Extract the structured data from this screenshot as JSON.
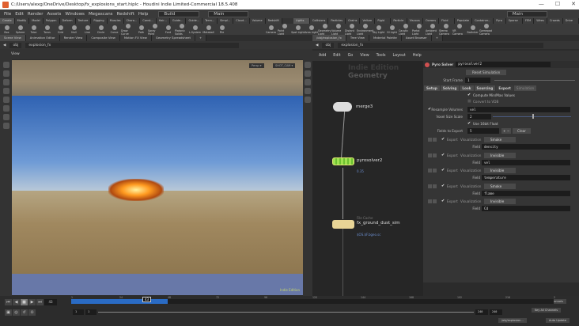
{
  "window": {
    "title": "C:/Users/alexg/OneDrive/Desktop/fx_explosions_start.hiplc - Houdini Indie Limited-Commercial 18.5.408",
    "controls": [
      "—",
      "☐",
      "✕"
    ]
  },
  "menu": {
    "items": [
      "File",
      "Edit",
      "Render",
      "Assets",
      "Windows",
      "Megascans",
      "Redshift",
      "Help"
    ],
    "desktop": "Build",
    "desktop_right": "Main"
  },
  "shelf_tabs": [
    "Create",
    "Modify",
    "Model",
    "Polygon",
    "Deform",
    "Texture",
    "Rigging",
    "Muscles",
    "Chara...",
    "Const...",
    "Hair...",
    "Guide...",
    "Guide...",
    "Terra...",
    "Simpl...",
    "Cloud...",
    "Volume",
    "Redshift",
    "Lights and...",
    "Collisions",
    "Particles",
    "Grains",
    "Vellum",
    "Rigid Bod...",
    "Particle Fl...",
    "Viscous Fl...",
    "Oceans",
    "Fluid Con...",
    "Populate C...",
    "Container...",
    "Pyro FX",
    "Sparse Pyr...",
    "FEM",
    "Wires",
    "Crowds",
    "Drive Sim..."
  ],
  "shelf_tools": [
    "Box",
    "Sphere",
    "Tube",
    "Torus",
    "Grid",
    "Null",
    "Line",
    "Circle",
    "Curve",
    "Draw Curve",
    "Path",
    "Spray Paint",
    "Font",
    "Platonic Solids",
    "L-System",
    "Metaball",
    "File",
    "Camera",
    "Point Light",
    "Spot Light",
    "Area Light",
    "Geometry Light",
    "Volume Light",
    "Distant Light",
    "Environment Light",
    "Sky Light",
    "GI Light",
    "Caustic Light",
    "Portal Light",
    "Ambient Light",
    "Stereo Camera",
    "VR Camera",
    "Switcher",
    "Gamepad Camera"
  ],
  "left_pane": {
    "tabs": [
      "Scene View",
      "Animation Editor",
      "Render View",
      "Composite View",
      "Motion FX View",
      "Geometry Spreadsheet"
    ],
    "path": [
      "obj",
      "explosion_fx"
    ],
    "view_label": "View",
    "persp": "Persp ▾",
    "camera": "SHOT_CAM ▾",
    "watermark": "Indie Edition"
  },
  "right_pane": {
    "tabs": [
      "/obj/explosion_fx",
      "Tree View",
      "Material Palette",
      "Asset Browser"
    ],
    "path": [
      "obj",
      "explosion_fx"
    ],
    "menu": [
      "Add",
      "Edit",
      "Go",
      "View",
      "Tools",
      "Layout",
      "Help"
    ],
    "watermark_1": "Indie Edition",
    "watermark_2": "Geometry"
  },
  "nodes": [
    {
      "name": "merge3",
      "type": "",
      "sub": ""
    },
    {
      "name": "pyrosolver2",
      "type": "",
      "sub": "0.35"
    },
    {
      "name": "fx_ground_dust_sim",
      "type": "File Cache",
      "sub": "$OS.$F.bgeo.sc"
    }
  ],
  "params": {
    "node_type": "Pyro Solver",
    "node_name": "pyrosolver2",
    "reset_button": "Reset Simulation",
    "start_frame_label": "Start Frame",
    "start_frame": "1",
    "tabs": [
      "Setup",
      "Solving",
      "Look",
      "Sourcing",
      "Export",
      "Simulation"
    ],
    "compute_minmax": "Compute Min/Max Values",
    "convert_vdb": "Convert to VDB",
    "resample_label": "Resample Volumes",
    "resample_value": "vel",
    "voxel_label": "Voxel Size Scale",
    "voxel_value": "2",
    "voxel_slider": 0.5,
    "use16": "Use 16bit Float",
    "fields_label": "Fields to Export",
    "fields_count": "5",
    "clear": "Clear",
    "export_label": "Export",
    "vis_label": "Visualization",
    "field_label": "Field",
    "fields": [
      {
        "vis": "Smoke",
        "field": "density"
      },
      {
        "vis": "Invisible",
        "field": "vel"
      },
      {
        "vis": "Invisible",
        "field": "temperature"
      },
      {
        "vis": "Smoke",
        "field": "flame"
      },
      {
        "vis": "Invisible",
        "field": "Cd"
      }
    ]
  },
  "timeline": {
    "current_frame": "43",
    "start": "1",
    "start2": "1",
    "end": "240",
    "end2": "240",
    "ticks": [
      "1",
      "24",
      "48",
      "72",
      "96",
      "120",
      "144",
      "168",
      "192",
      "216",
      "2"
    ],
    "cached_fraction": 0.2,
    "keys": "0 keys, 0/0 channels",
    "key_all": "Key All Channels",
    "status_path": "/obj/explosion...",
    "auto_update": "Auto Update"
  }
}
